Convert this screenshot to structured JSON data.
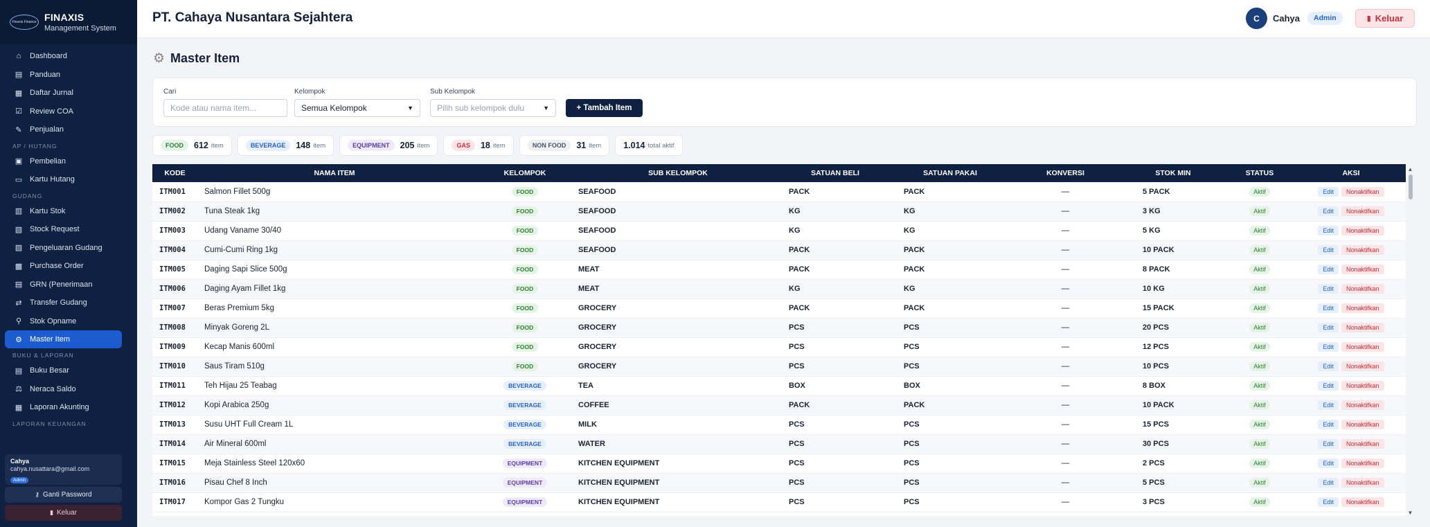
{
  "sidebar": {
    "brand_logo_text": "Finaxis Finance",
    "brand_title": "FINAXIS",
    "brand_subtitle": "Management System",
    "items": [
      {
        "label": "Dashboard",
        "icon": "home-icon"
      },
      {
        "label": "Panduan",
        "icon": "book-icon"
      },
      {
        "label": "Daftar Jurnal",
        "icon": "journal-icon"
      },
      {
        "label": "Review COA",
        "icon": "checkbox-icon"
      },
      {
        "label": "Penjualan",
        "icon": "sales-icon"
      },
      {
        "label": "Pembelian",
        "icon": "purchase-icon"
      },
      {
        "label": "Kartu Hutang",
        "icon": "card-icon"
      },
      {
        "label": "Kartu Stok",
        "icon": "stock-icon"
      },
      {
        "label": "Stock Request",
        "icon": "request-icon"
      },
      {
        "label": "Pengeluaran Gudang",
        "icon": "outbox-icon"
      },
      {
        "label": "Purchase Order",
        "icon": "order-icon"
      },
      {
        "label": "GRN (Penerimaan",
        "icon": "receive-icon"
      },
      {
        "label": "Transfer Gudang",
        "icon": "transfer-icon"
      },
      {
        "label": "Stok Opname",
        "icon": "search-icon"
      },
      {
        "label": "Master Item",
        "icon": "gear-icon"
      },
      {
        "label": "Buku Besar",
        "icon": "ledger-icon"
      },
      {
        "label": "Neraca Saldo",
        "icon": "balance-icon"
      },
      {
        "label": "Laporan Akunting",
        "icon": "report-icon"
      }
    ],
    "sections": {
      "ap": "AP / HUTANG",
      "gudang": "GUDANG",
      "buku": "BUKU & LAPORAN",
      "keuangan": "LAPORAN KEUANGAN"
    },
    "user": {
      "name": "Cahya",
      "email": "cahya.nusattara@gmail.com",
      "role": "Admin"
    },
    "change_password": "Ganti Password",
    "logout": "Keluar"
  },
  "header": {
    "company": "PT. Cahaya Nusantara Sejahtera",
    "avatar_initial": "C",
    "user": "Cahya",
    "role": "Admin",
    "logout": "Keluar"
  },
  "page": {
    "title": "Master Item"
  },
  "filters": {
    "search_label": "Cari",
    "search_placeholder": "Kode atau nama item...",
    "group_label": "Kelompok",
    "group_value": "Semua Kelompok",
    "subgroup_label": "Sub Kelompok",
    "subgroup_value": "Pilih sub kelompok dulu",
    "add_button": "+ Tambah Item"
  },
  "stats": [
    {
      "tag": "FOOD",
      "count": "612",
      "unit": "item",
      "bg": "#e6f4e8",
      "fg": "#2e7d32"
    },
    {
      "tag": "BEVERAGE",
      "count": "148",
      "unit": "item",
      "bg": "#e5efff",
      "fg": "#2762c9"
    },
    {
      "tag": "EQUIPMENT",
      "count": "205",
      "unit": "item",
      "bg": "#eeeafb",
      "fg": "#5b3fa8"
    },
    {
      "tag": "GAS",
      "count": "18",
      "unit": "item",
      "bg": "#fde4e6",
      "fg": "#c8303d"
    },
    {
      "tag": "NON FOOD",
      "count": "31",
      "unit": "item",
      "bg": "#eef0f3",
      "fg": "#4a5366"
    }
  ],
  "total": {
    "count": "1.014",
    "unit": "total aktif"
  },
  "table": {
    "columns": [
      "KODE",
      "NAMA ITEM",
      "KELOMPOK",
      "SUB KELOMPOK",
      "SATUAN BELI",
      "SATUAN PAKAI",
      "KONVERSI",
      "STOK MIN",
      "STATUS",
      "AKSI"
    ],
    "edit_label": "Edit",
    "deactivate_label": "Nonaktifkan",
    "rows": [
      {
        "kode": "ITM001",
        "nama": "Salmon Fillet 500g",
        "kelompok": "FOOD",
        "sub": "SEAFOOD",
        "beli": "PACK",
        "pakai": "PACK",
        "konversi": "—",
        "stok": "5 PACK",
        "status": "Aktif"
      },
      {
        "kode": "ITM002",
        "nama": "Tuna Steak 1kg",
        "kelompok": "FOOD",
        "sub": "SEAFOOD",
        "beli": "KG",
        "pakai": "KG",
        "konversi": "—",
        "stok": "3 KG",
        "status": "Aktif"
      },
      {
        "kode": "ITM003",
        "nama": "Udang Vaname 30/40",
        "kelompok": "FOOD",
        "sub": "SEAFOOD",
        "beli": "KG",
        "pakai": "KG",
        "konversi": "—",
        "stok": "5 KG",
        "status": "Aktif"
      },
      {
        "kode": "ITM004",
        "nama": "Cumi-Cumi Ring 1kg",
        "kelompok": "FOOD",
        "sub": "SEAFOOD",
        "beli": "PACK",
        "pakai": "PACK",
        "konversi": "—",
        "stok": "10 PACK",
        "status": "Aktif"
      },
      {
        "kode": "ITM005",
        "nama": "Daging Sapi Slice 500g",
        "kelompok": "FOOD",
        "sub": "MEAT",
        "beli": "PACK",
        "pakai": "PACK",
        "konversi": "—",
        "stok": "8 PACK",
        "status": "Aktif"
      },
      {
        "kode": "ITM006",
        "nama": "Daging Ayam Fillet 1kg",
        "kelompok": "FOOD",
        "sub": "MEAT",
        "beli": "KG",
        "pakai": "KG",
        "konversi": "—",
        "stok": "10 KG",
        "status": "Aktif"
      },
      {
        "kode": "ITM007",
        "nama": "Beras Premium 5kg",
        "kelompok": "FOOD",
        "sub": "GROCERY",
        "beli": "PACK",
        "pakai": "PACK",
        "konversi": "—",
        "stok": "15 PACK",
        "status": "Aktif"
      },
      {
        "kode": "ITM008",
        "nama": "Minyak Goreng 2L",
        "kelompok": "FOOD",
        "sub": "GROCERY",
        "beli": "PCS",
        "pakai": "PCS",
        "konversi": "—",
        "stok": "20 PCS",
        "status": "Aktif"
      },
      {
        "kode": "ITM009",
        "nama": "Kecap Manis 600ml",
        "kelompok": "FOOD",
        "sub": "GROCERY",
        "beli": "PCS",
        "pakai": "PCS",
        "konversi": "—",
        "stok": "12 PCS",
        "status": "Aktif"
      },
      {
        "kode": "ITM010",
        "nama": "Saus Tiram 510g",
        "kelompok": "FOOD",
        "sub": "GROCERY",
        "beli": "PCS",
        "pakai": "PCS",
        "konversi": "—",
        "stok": "10 PCS",
        "status": "Aktif"
      },
      {
        "kode": "ITM011",
        "nama": "Teh Hijau 25 Teabag",
        "kelompok": "BEVERAGE",
        "sub": "TEA",
        "beli": "BOX",
        "pakai": "BOX",
        "konversi": "—",
        "stok": "8 BOX",
        "status": "Aktif"
      },
      {
        "kode": "ITM012",
        "nama": "Kopi Arabica 250g",
        "kelompok": "BEVERAGE",
        "sub": "COFFEE",
        "beli": "PACK",
        "pakai": "PACK",
        "konversi": "—",
        "stok": "10 PACK",
        "status": "Aktif"
      },
      {
        "kode": "ITM013",
        "nama": "Susu UHT Full Cream 1L",
        "kelompok": "BEVERAGE",
        "sub": "MILK",
        "beli": "PCS",
        "pakai": "PCS",
        "konversi": "—",
        "stok": "15 PCS",
        "status": "Aktif"
      },
      {
        "kode": "ITM014",
        "nama": "Air Mineral 600ml",
        "kelompok": "BEVERAGE",
        "sub": "WATER",
        "beli": "PCS",
        "pakai": "PCS",
        "konversi": "—",
        "stok": "30 PCS",
        "status": "Aktif"
      },
      {
        "kode": "ITM015",
        "nama": "Meja Stainless Steel 120x60",
        "kelompok": "EQUIPMENT",
        "sub": "KITCHEN EQUIPMENT",
        "beli": "PCS",
        "pakai": "PCS",
        "konversi": "—",
        "stok": "2 PCS",
        "status": "Aktif"
      },
      {
        "kode": "ITM016",
        "nama": "Pisau Chef 8 Inch",
        "kelompok": "EQUIPMENT",
        "sub": "KITCHEN EQUIPMENT",
        "beli": "PCS",
        "pakai": "PCS",
        "konversi": "—",
        "stok": "5 PCS",
        "status": "Aktif"
      },
      {
        "kode": "ITM017",
        "nama": "Kompor Gas 2 Tungku",
        "kelompok": "EQUIPMENT",
        "sub": "KITCHEN EQUIPMENT",
        "beli": "PCS",
        "pakai": "PCS",
        "konversi": "—",
        "stok": "3 PCS",
        "status": "Aktif"
      }
    ]
  }
}
